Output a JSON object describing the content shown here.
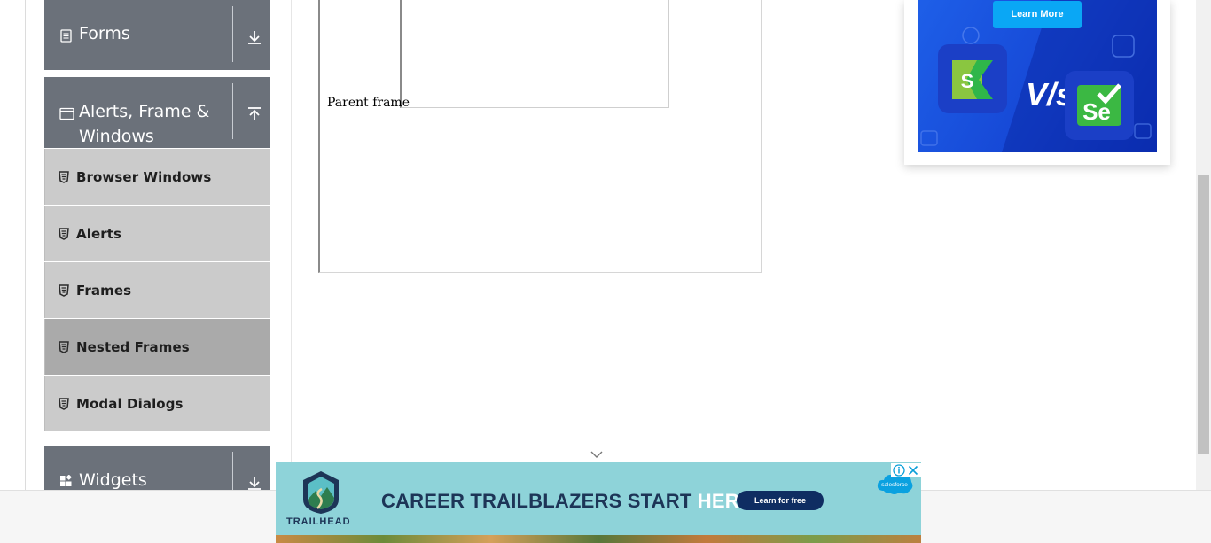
{
  "sidebar": {
    "groups": [
      {
        "label": "Forms"
      },
      {
        "label_line1": "Alerts, Frame &",
        "label_line2": "Windows"
      },
      {
        "label": "Widgets"
      }
    ],
    "items": [
      {
        "label": "Browser Windows"
      },
      {
        "label": "Alerts"
      },
      {
        "label": "Frames"
      },
      {
        "label": "Nested Frames"
      },
      {
        "label": "Modal Dialogs"
      }
    ]
  },
  "main": {
    "parent_frame_text": "Parent frame"
  },
  "ad_right": {
    "button_label": "Learn More",
    "vs_text": "V/s"
  },
  "ad_bottom": {
    "headline_part1": "CAREER TRAILBLAZERS START ",
    "headline_highlight": "HERE.",
    "cta_label": "Learn for free",
    "brand": "TRAILHEAD",
    "sponsor": "salesforce"
  },
  "colors": {
    "group_bg": "#6b717a",
    "item_bg": "#cbcbcb",
    "item_active_bg": "#aaaaaa",
    "ad_bottom_bg": "#8ed3d9",
    "ad_right_button": "#0aa7f5"
  },
  "icons": {
    "forms": "document-icon",
    "alerts": "window-icon",
    "widgets": "widgets-icon",
    "item": "html5-badge-icon",
    "expand": "download-arrow-icon",
    "collapse": "upload-arrow-icon"
  }
}
